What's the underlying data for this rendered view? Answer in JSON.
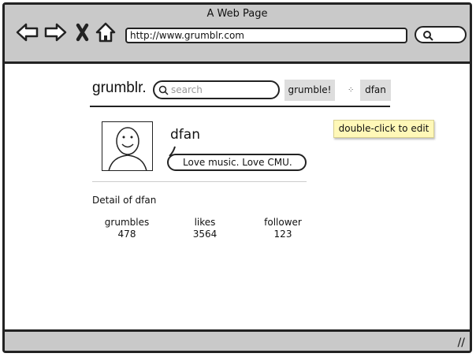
{
  "window": {
    "title": "A Web Page"
  },
  "browser": {
    "url": "http://www.grumblr.com"
  },
  "site": {
    "brand": "grumblr.",
    "search_placeholder": "search",
    "grumble_label": "grumble!",
    "user_label": "dfan"
  },
  "profile": {
    "name": "dfan",
    "bio": "Love music. Love CMU.",
    "tooltip": "double-click to edit"
  },
  "detail": {
    "title": "Detail of dfan",
    "stats": [
      {
        "label": "grumbles",
        "value": "478"
      },
      {
        "label": "likes",
        "value": "3564"
      },
      {
        "label": "follower",
        "value": "123"
      }
    ]
  }
}
